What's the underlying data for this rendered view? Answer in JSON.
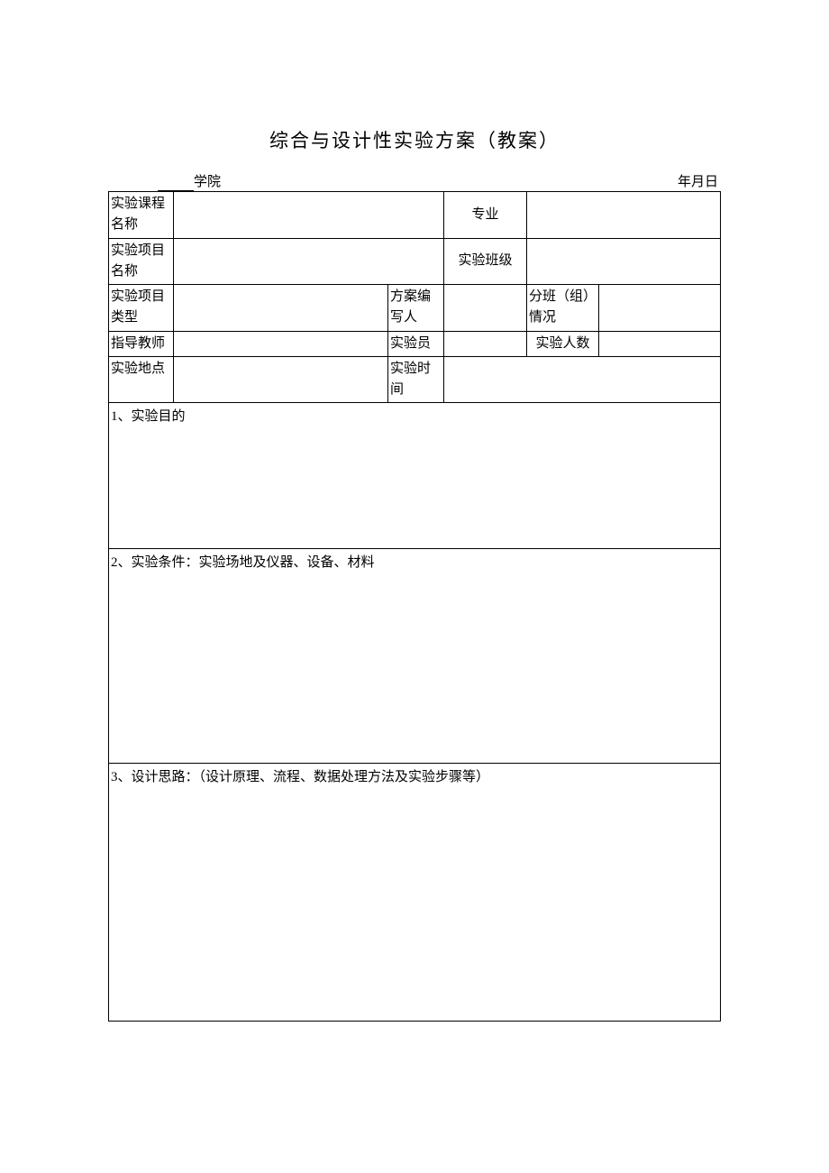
{
  "title": "综合与设计性实验方案（教案）",
  "header": {
    "college_suffix": "学院",
    "date_label": "年月日"
  },
  "rows": {
    "r1": {
      "label1": "实验课程名称",
      "value1": "",
      "label2": "专业",
      "value2": ""
    },
    "r2": {
      "label1": "实验项目名称",
      "value1": "",
      "label2": "实验班级",
      "value2": ""
    },
    "r3": {
      "label1": "实验项目类型",
      "value1": "",
      "label2": "方案编写人",
      "value2": "",
      "label3": "分班（组）情况",
      "value3": ""
    },
    "r4": {
      "label1": "指导教师",
      "value1": "",
      "label2": "实验员",
      "value2": "",
      "label3": "实验人数",
      "value3": ""
    },
    "r5": {
      "label1": "实验地点",
      "value1": "",
      "label2": "实验时间",
      "value2": ""
    }
  },
  "sections": {
    "s1": "1、实验目的",
    "s2": "2、实验条件：实验场地及仪器、设备、材料",
    "s3": "3、设计思路：（设计原理、流程、数据处理方法及实验步骤等）"
  }
}
